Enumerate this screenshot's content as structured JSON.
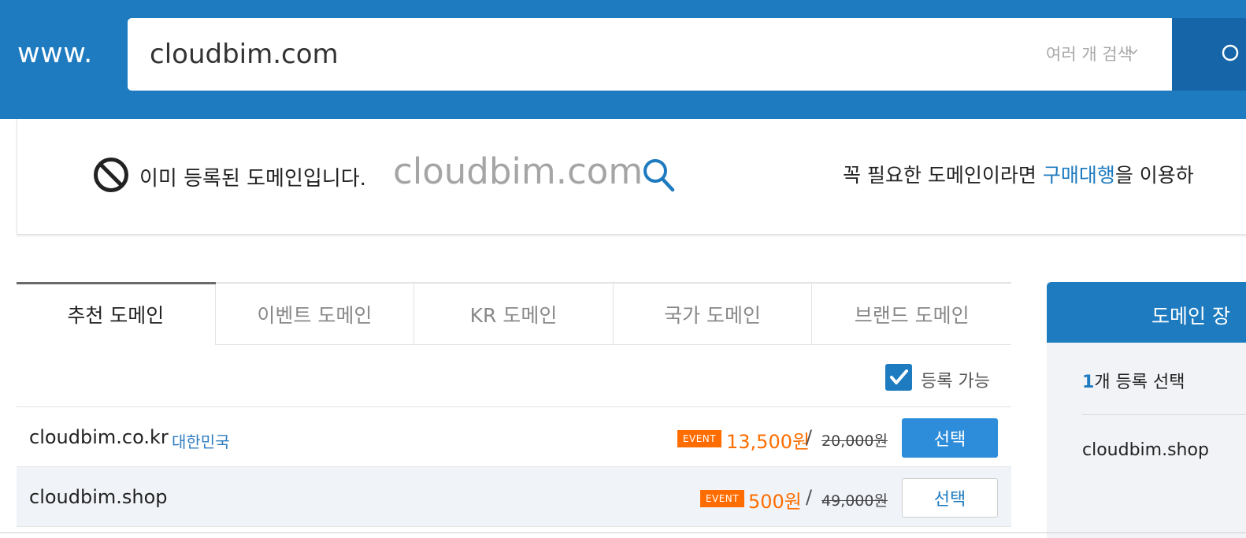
{
  "header": {
    "prefix": "www.",
    "search_value": "cloudbim.com",
    "multi_search_label": "여러 개 검색",
    "accent_color": "#1e7bc0"
  },
  "notice": {
    "message": "이미 등록된 도메인입니다.",
    "domain": "cloudbim.com",
    "right_prefix": "꼭 필요한 도메인이라면 ",
    "right_link": "구매대행",
    "right_suffix": "을 이용하"
  },
  "tabs": [
    {
      "label": "추천 도메인",
      "active": true
    },
    {
      "label": "이벤트 도메인",
      "active": false
    },
    {
      "label": "KR 도메인",
      "active": false
    },
    {
      "label": "국가 도메인",
      "active": false
    },
    {
      "label": "브랜드 도메인",
      "active": false
    }
  ],
  "filter": {
    "available_label": "등록 가능",
    "available_checked": true
  },
  "results": [
    {
      "domain": "cloudbim.co.kr",
      "country": "대한민국",
      "badge": "EVENT",
      "price": "13,500원",
      "separator": "/",
      "original_price": "20,000원",
      "button_label": "선택",
      "selected": false
    },
    {
      "domain": "cloudbim.shop",
      "country": "",
      "badge": "EVENT",
      "price": "500원",
      "separator": "/",
      "original_price": "49,000원",
      "button_label": "선택",
      "selected": true
    }
  ],
  "cart": {
    "title": "도메인 장",
    "count_number": "1",
    "count_text": "개 등록 선택",
    "items": [
      "cloudbim.shop"
    ]
  },
  "icons": {
    "multi_search": "chevron-down-icon",
    "search_button": "search-icon",
    "notice_status": "ban-icon",
    "notice_search": "search-icon",
    "filter_checkbox": "checkmark-icon"
  },
  "colors": {
    "brand_blue": "#1e7bc0",
    "event_orange": "#ff6d00",
    "button_blue": "#2e8ddb"
  }
}
